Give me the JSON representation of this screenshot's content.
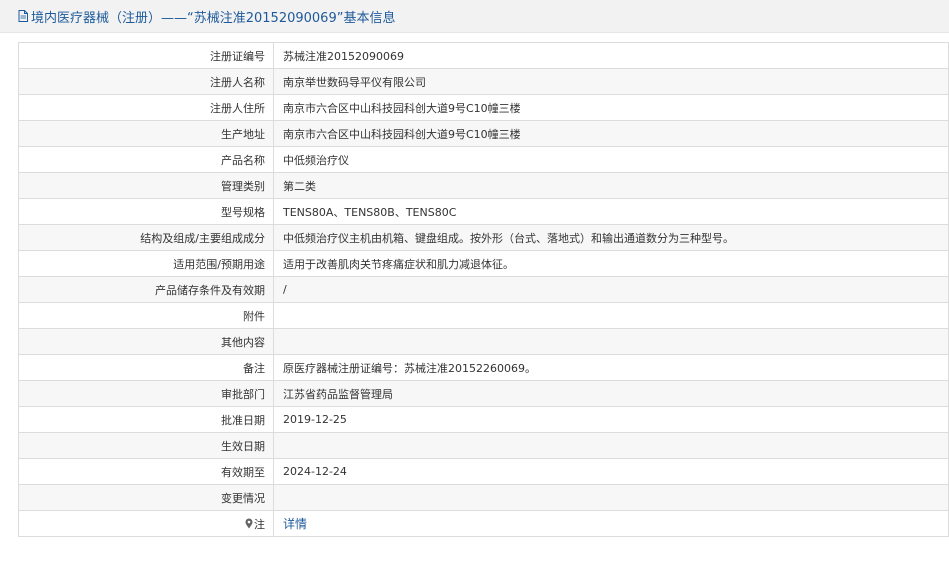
{
  "header": {
    "title": "境内医疗器械（注册）——“苏械注准20152090069”基本信息"
  },
  "rows": [
    {
      "label": "注册证编号",
      "value": "苏械注准20152090069"
    },
    {
      "label": "注册人名称",
      "value": "南京举世数码导平仪有限公司"
    },
    {
      "label": "注册人住所",
      "value": "南京市六合区中山科技园科创大道9号C10幢三楼"
    },
    {
      "label": "生产地址",
      "value": "南京市六合区中山科技园科创大道9号C10幢三楼"
    },
    {
      "label": "产品名称",
      "value": "中低频治疗仪"
    },
    {
      "label": "管理类别",
      "value": "第二类"
    },
    {
      "label": "型号规格",
      "value": "TENS80A、TENS80B、TENS80C"
    },
    {
      "label": "结构及组成/主要组成成分",
      "value": "中低频治疗仪主机由机箱、键盘组成。按外形（台式、落地式）和输出通道数分为三种型号。"
    },
    {
      "label": "适用范围/预期用途",
      "value": "适用于改善肌肉关节疼痛症状和肌力减退体征。"
    },
    {
      "label": "产品储存条件及有效期",
      "value": "/"
    },
    {
      "label": "附件",
      "value": ""
    },
    {
      "label": "其他内容",
      "value": ""
    },
    {
      "label": "备注",
      "value": "原医疗器械注册证编号：苏械注准20152260069。"
    },
    {
      "label": "审批部门",
      "value": "江苏省药品监督管理局"
    },
    {
      "label": "批准日期",
      "value": "2019-12-25"
    },
    {
      "label": "生效日期",
      "value": ""
    },
    {
      "label": "有效期至",
      "value": "2024-12-24"
    },
    {
      "label": "变更情况",
      "value": ""
    },
    {
      "label": "注",
      "value": "详情"
    }
  ],
  "icons": {
    "header_icon": "document-icon",
    "note_icon": "pin-icon"
  },
  "colors": {
    "link": "#1e5a9b",
    "header_bg": "#f2f2f2"
  }
}
